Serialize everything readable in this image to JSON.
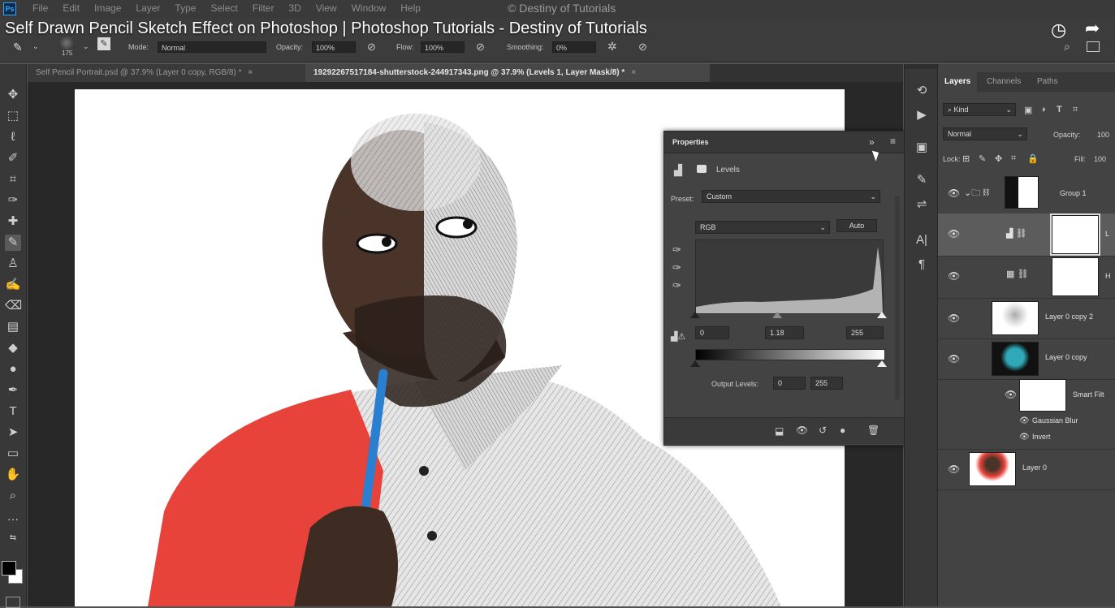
{
  "menubar": {
    "items": [
      "File",
      "Edit",
      "Image",
      "Layer",
      "Type",
      "Select",
      "Filter",
      "3D",
      "View",
      "Window",
      "Help"
    ],
    "copyright": "© Destiny of Tutorials"
  },
  "video_title": "Self Drawn Pencil Sketch Effect on Photoshop | Photoshop Tutorials - Destiny of Tutorials",
  "options": {
    "brush_size": "175",
    "mode_label": "Mode:",
    "mode_value": "Normal",
    "opacity_label": "Opacity:",
    "opacity_value": "100%",
    "flow_label": "Flow:",
    "flow_value": "100%",
    "smoothing_label": "Smoothing:",
    "smoothing_value": "0%"
  },
  "tabs": [
    {
      "label": "Self Pencil Portrait.psd @ 37.9% (Layer 0 copy, RGB/8) *",
      "close": "×"
    },
    {
      "label": "19292267517184-shutterstock-244917343.png @ 37.9% (Levels 1, Layer Mask/8) *",
      "close": "×"
    }
  ],
  "properties": {
    "title": "Properties",
    "collapse": "»",
    "panel_name": "Levels",
    "preset_label": "Preset:",
    "preset_value": "Custom",
    "channel": "RGB",
    "auto_button": "Auto",
    "input_black": "0",
    "input_gamma": "1.18",
    "input_white": "255",
    "output_label": "Output Levels:",
    "output_black": "0",
    "output_white": "255"
  },
  "layers_panel": {
    "tabs": [
      "Layers",
      "Channels",
      "Paths"
    ],
    "kind_label": "Kind",
    "blend_mode": "Normal",
    "opacity_label": "Opacity:",
    "opacity_value": "100",
    "lock_label": "Lock:",
    "fill_label": "Fill:",
    "fill_value": "100",
    "layers": [
      {
        "name": "Group 1"
      },
      {
        "name": "L"
      },
      {
        "name": "H"
      },
      {
        "name": "Layer 0 copy 2"
      },
      {
        "name": "Layer 0 copy"
      },
      {
        "name": "Smart Filt"
      },
      {
        "name": "Gaussian Blur"
      },
      {
        "name": "Invert"
      },
      {
        "name": "Layer 0"
      }
    ]
  },
  "colors": {
    "ui_dark": "#383838",
    "ui_panel": "#434343",
    "accent_blue": "#31a8ff",
    "shirt_red": "#e8433b",
    "pencil_blue": "#2b7fd0",
    "teal_thumb": "#2fa8b8"
  }
}
